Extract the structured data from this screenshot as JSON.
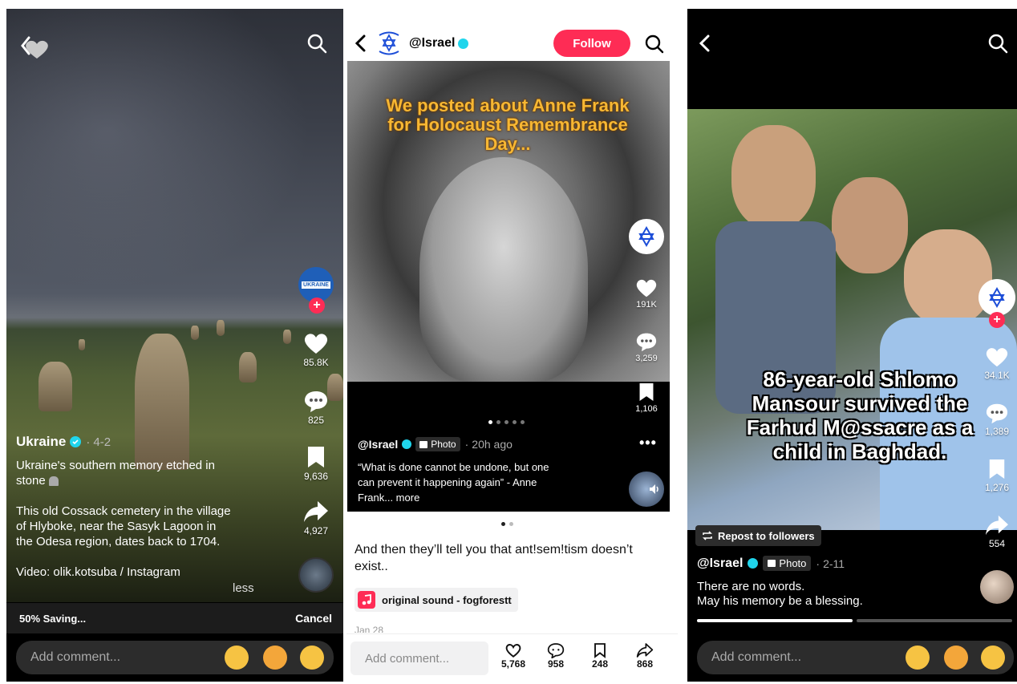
{
  "panel1": {
    "author": "Ukraine",
    "date": "4-2",
    "caption_line1": "Ukraine's southern memory etched in",
    "caption_line2": "stone",
    "body_line1": "This old Cossack cemetery in the village",
    "body_line2": "of Hlyboke, near the Sasyk Lagoon in",
    "body_line3": "the Odesa region, dates back to 1704.",
    "credit": "Video: olik.kotsuba / Instagram",
    "less": "less",
    "avatar_text": "UKRAINE",
    "likes": "85.8K",
    "comments": "825",
    "saves": "9,636",
    "shares": "4,927",
    "saving_text": "50% Saving...",
    "cancel": "Cancel",
    "comment_placeholder": "Add comment..."
  },
  "panel2": {
    "handle": "@Israel",
    "follow": "Follow",
    "headline": "We posted about Anne Frank for Holocaust Remembrance Day...",
    "likes": "191K",
    "comments": "3,259",
    "saves": "1,106",
    "post_handle": "@Israel",
    "photo_label": "Photo",
    "time": "20h ago",
    "quote_line1": "“What is done cannot be undone, but one",
    "quote_line2": "can prevent it happening again” - Anne",
    "quote_line3": "Frank... more",
    "comment_line1": "And then they’ll tell you that ant!sem!tism doesn’t",
    "comment_line2": "exist..",
    "sound": "original sound - fogforestt",
    "date_partial": "Jan 28",
    "comment_placeholder": "Add comment...",
    "bar_likes": "5,768",
    "bar_comments": "958",
    "bar_saves": "248",
    "bar_shares": "868"
  },
  "panel3": {
    "caption": "86-year-old Shlomo Mansour survived the Farhud M@ssacre as a child in Baghdad.",
    "likes": "34.1K",
    "comments": "1,389",
    "saves": "1,276",
    "shares": "554",
    "repost": "Repost to followers",
    "handle": "@Israel",
    "photo_label": "Photo",
    "date": "2-11",
    "desc_line1": "There are no words.",
    "desc_line2": "May his memory be a blessing.",
    "comment_placeholder": "Add comment..."
  },
  "colors": {
    "accent": "#fe2c55",
    "verified": "#20d5ec",
    "sound_icon": "#fe2c55"
  },
  "icons": [
    "back-arrow-icon",
    "search-icon",
    "heart-icon",
    "comment-icon",
    "bookmark-icon",
    "share-icon",
    "more-icon",
    "verified-icon",
    "star-of-david-icon",
    "music-note-icon",
    "repost-icon",
    "sound-icon"
  ]
}
